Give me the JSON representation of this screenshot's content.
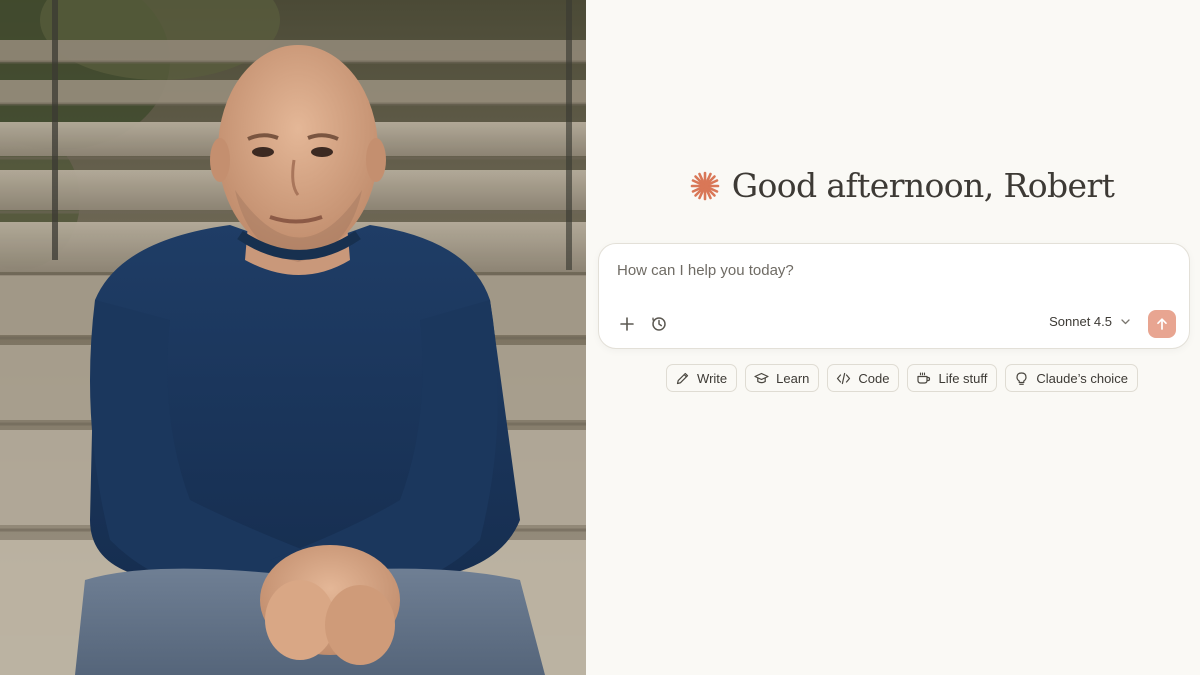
{
  "greeting": {
    "icon": "asterisk-spark-icon",
    "text": "Good afternoon, Robert",
    "accent_color": "#d97757"
  },
  "composer": {
    "placeholder": "How can I help you today?",
    "value": "",
    "add_icon": "plus-icon",
    "history_icon": "clock-history-icon",
    "model_label": "Sonnet 4.5",
    "model_dropdown_icon": "chevron-down-icon",
    "send_icon": "arrow-up-icon",
    "send_color": "#e8a591"
  },
  "suggestions": [
    {
      "label": "Write",
      "icon": "pencil-icon"
    },
    {
      "label": "Learn",
      "icon": "graduation-cap-icon"
    },
    {
      "label": "Code",
      "icon": "code-brackets-icon"
    },
    {
      "label": "Life stuff",
      "icon": "coffee-cup-icon"
    },
    {
      "label": "Claude’s choice",
      "icon": "lightbulb-icon"
    }
  ],
  "photo": {
    "subject": "portrait-photo"
  }
}
